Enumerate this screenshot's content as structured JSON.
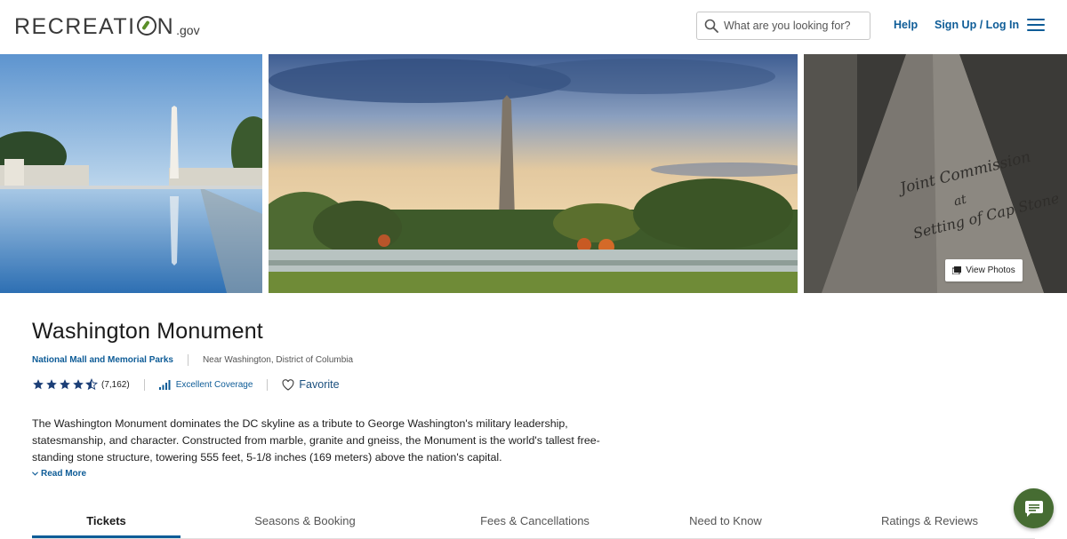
{
  "header": {
    "logo_text": "RECREATION",
    "logo_suffix": ".gov",
    "search_placeholder": "What are you looking for?",
    "help_label": "Help",
    "signup_label": "Sign Up / Log In"
  },
  "gallery": {
    "view_photos_label": "View Photos",
    "photo_3_inscription": "Joint Commission at Setting of Cap Stone"
  },
  "facility": {
    "title": "Washington Monument",
    "parent_area": "National Mall and Memorial Parks",
    "location": "Near Washington, District of Columbia",
    "rating_value": 4.5,
    "rating_count": "(7,162)",
    "coverage_label": "Excellent Coverage",
    "favorite_label": "Favorite",
    "description": "The Washington Monument dominates the DC skyline as a tribute to George Washington's military leadership, statesmanship, and character. Constructed from marble, granite and gneiss, the Monument is the world's tallest free-standing stone structure, towering 555 feet, 5-1/8 inches (169 meters) above the nation's capital.",
    "read_more_label": "Read More"
  },
  "tabs": [
    {
      "label": "Tickets",
      "active": true
    },
    {
      "label": "Seasons & Booking",
      "active": false
    },
    {
      "label": "Fees & Cancellations",
      "active": false
    },
    {
      "label": "Need to Know",
      "active": false
    },
    {
      "label": "Ratings & Reviews",
      "active": false
    }
  ],
  "colors": {
    "link": "#0e5c97",
    "star": "#1c3f77",
    "chat_button": "#466c32"
  },
  "icons": [
    "search-icon",
    "menu-icon",
    "star-icon",
    "signal-icon",
    "heart-icon",
    "chevron-down-icon",
    "photo-icon",
    "chat-icon"
  ]
}
